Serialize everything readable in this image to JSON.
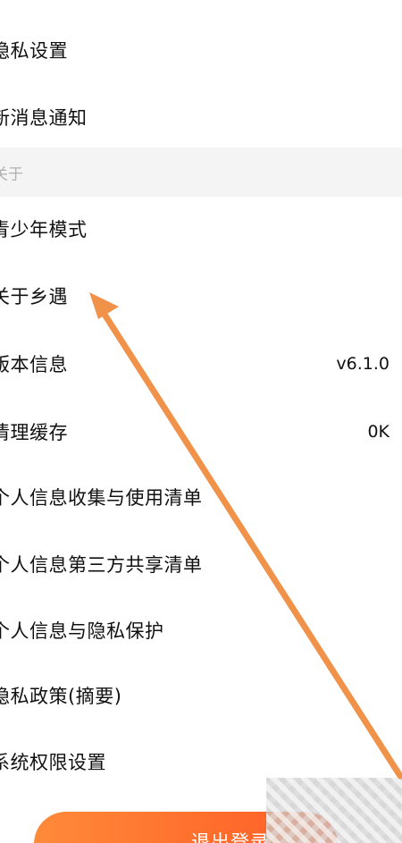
{
  "settings": {
    "items_top": [
      {
        "label": "隐私设置",
        "value": ""
      },
      {
        "label": "新消息通知",
        "value": ""
      }
    ],
    "section_about": {
      "title": "关于"
    },
    "items_about": [
      {
        "label": "青少年模式",
        "value": ""
      },
      {
        "label": "关于乡遇",
        "value": ""
      },
      {
        "label": "版本信息",
        "value": "v6.1.0"
      },
      {
        "label": "清理缓存",
        "value": "0K"
      },
      {
        "label": "个人信息收集与使用清单",
        "value": ""
      },
      {
        "label": "个人信息第三方共享清单",
        "value": ""
      },
      {
        "label": "个人信息与隐私保护",
        "value": ""
      },
      {
        "label": "隐私政策(摘要)",
        "value": ""
      },
      {
        "label": "系统权限设置",
        "value": ""
      }
    ],
    "logout_label": "退出登录"
  },
  "colors": {
    "accent": "#ff6d2c",
    "arrow": "#f0924a",
    "section_bg": "#f4f4f4"
  }
}
